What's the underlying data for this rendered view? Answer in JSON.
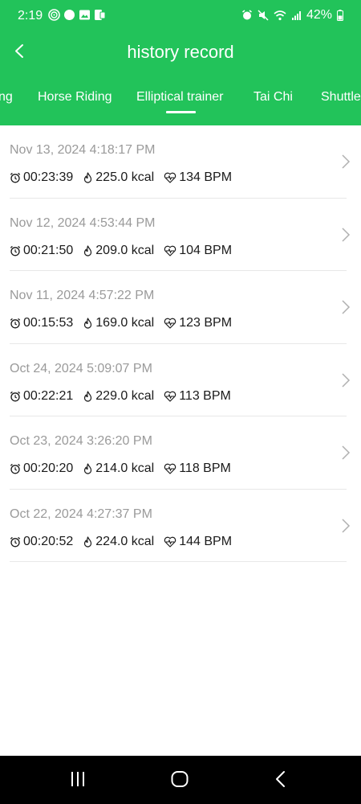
{
  "status": {
    "time": "2:19",
    "battery": "42%"
  },
  "header": {
    "title": "history record"
  },
  "tabs": [
    {
      "label": "ng"
    },
    {
      "label": "Horse Riding"
    },
    {
      "label": "Elliptical trainer"
    },
    {
      "label": "Tai Chi"
    },
    {
      "label": "Shuttle"
    }
  ],
  "records": [
    {
      "date": "Nov 13, 2024 4:18:17 PM",
      "duration": "00:23:39",
      "calories": "225.0 kcal",
      "heart_rate": "134 BPM"
    },
    {
      "date": "Nov 12, 2024 4:53:44 PM",
      "duration": "00:21:50",
      "calories": "209.0 kcal",
      "heart_rate": "104 BPM"
    },
    {
      "date": "Nov 11, 2024 4:57:22 PM",
      "duration": "00:15:53",
      "calories": "169.0 kcal",
      "heart_rate": "123 BPM"
    },
    {
      "date": "Oct 24, 2024 5:09:07 PM",
      "duration": "00:22:21",
      "calories": "229.0 kcal",
      "heart_rate": "113 BPM"
    },
    {
      "date": "Oct 23, 2024 3:26:20 PM",
      "duration": "00:20:20",
      "calories": "214.0 kcal",
      "heart_rate": "118 BPM"
    },
    {
      "date": "Oct 22, 2024 4:27:37 PM",
      "duration": "00:20:52",
      "calories": "224.0 kcal",
      "heart_rate": "144 BPM"
    }
  ],
  "colors": {
    "header_green": "#22c35a",
    "date_gray": "#9a9a9a"
  }
}
